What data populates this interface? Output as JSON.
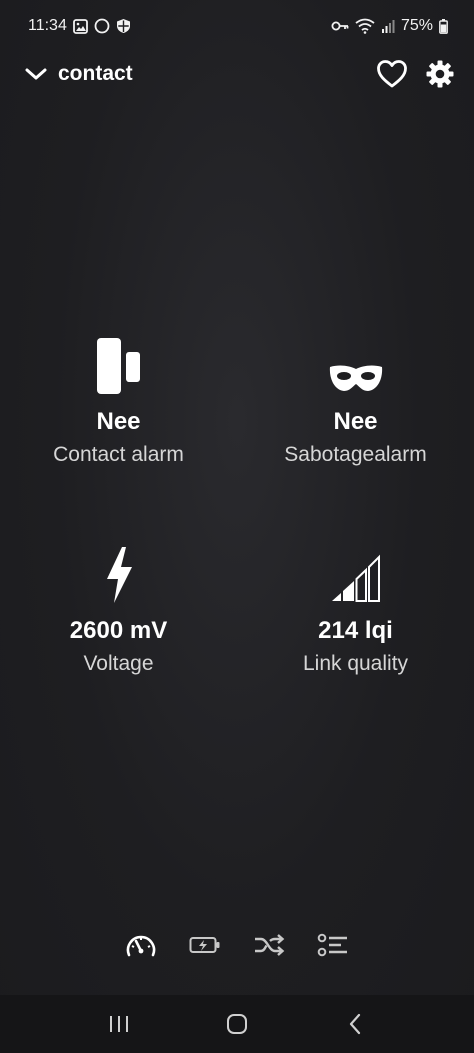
{
  "status_bar": {
    "time": "11:34",
    "battery_percent": "75%",
    "icons_left": [
      "gallery-icon",
      "circle-icon",
      "shield-icon"
    ],
    "icons_right": [
      "key-icon",
      "wifi-icon",
      "signal-icon",
      "battery-icon"
    ]
  },
  "header": {
    "title": "contact",
    "icons": [
      "chevron-down-icon",
      "heart-icon",
      "gear-icon"
    ]
  },
  "tiles": [
    {
      "value": "Nee",
      "label": "Contact alarm",
      "icon": "door-contact-icon"
    },
    {
      "value": "Nee",
      "label": "Sabotagealarm",
      "icon": "mask-icon"
    },
    {
      "value": "2600 mV",
      "label": "Voltage",
      "icon": "lightning-icon"
    },
    {
      "value": "214 lqi",
      "label": "Link quality",
      "icon": "signal-bars-icon"
    }
  ],
  "bottom_tabs": [
    "gauge-icon",
    "battery-charging-icon",
    "shuffle-icon",
    "list-icon"
  ],
  "nav_bar": [
    "recent-apps-icon",
    "home-icon",
    "back-icon"
  ],
  "colors": {
    "background": "#1e1e21",
    "text": "#ffffff",
    "label": "#d6d6d6"
  }
}
